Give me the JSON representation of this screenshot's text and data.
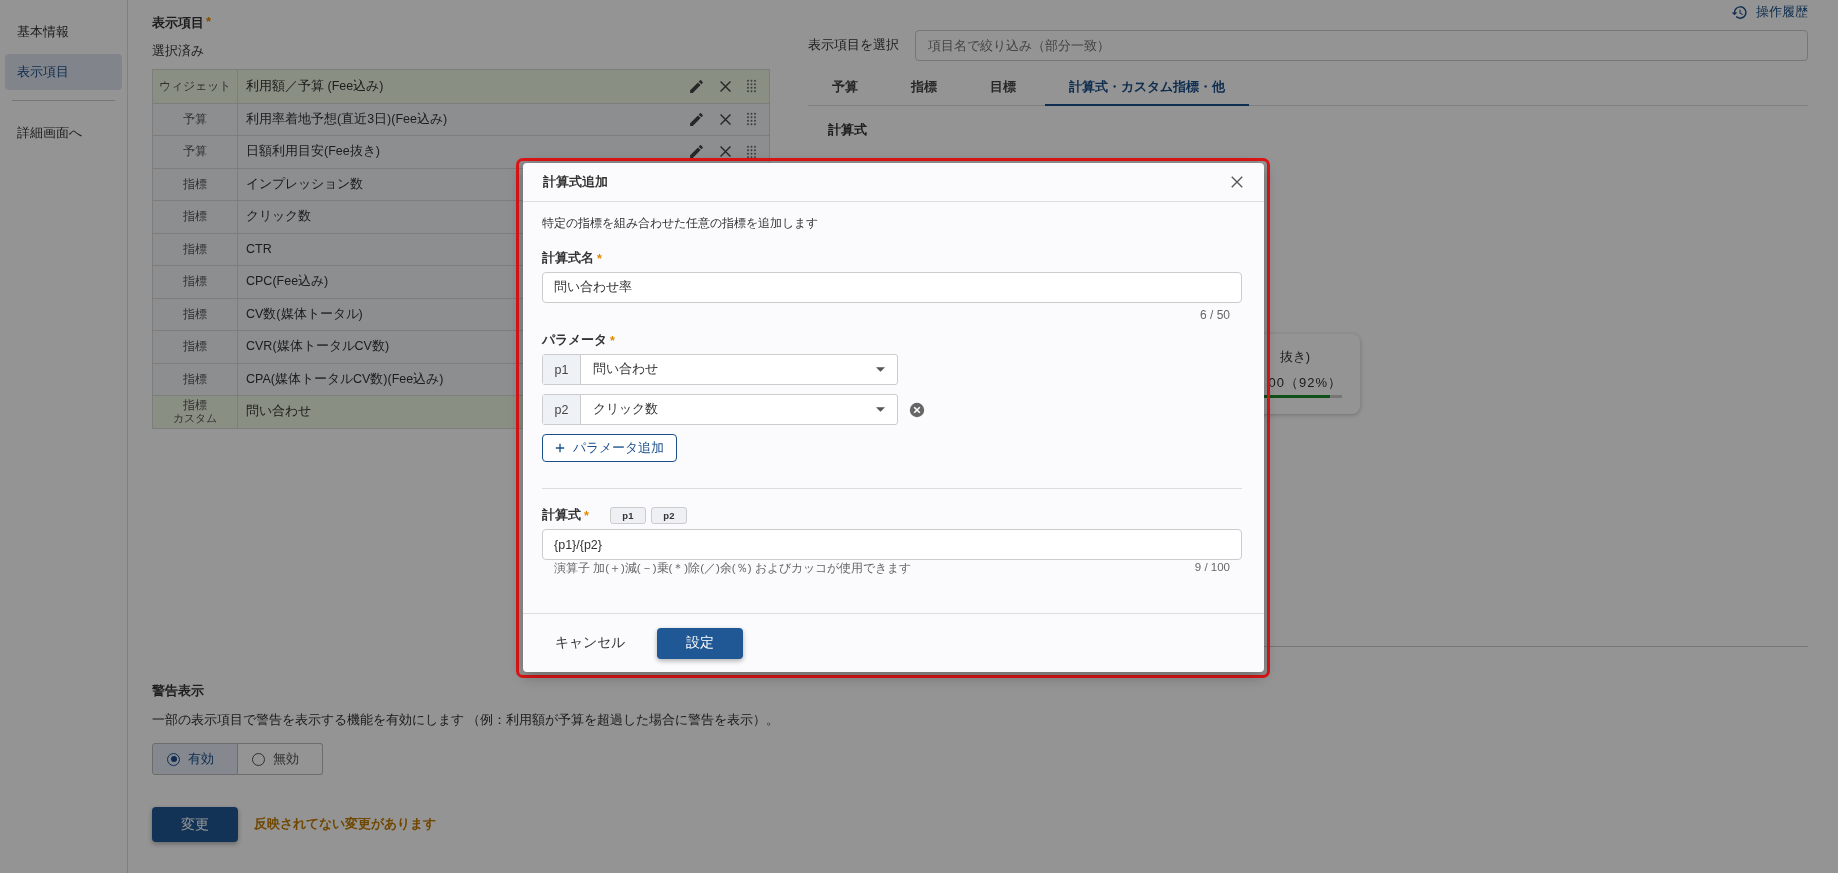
{
  "sidebar": {
    "items": [
      {
        "label": "基本情報",
        "selected": false
      },
      {
        "label": "表示項目",
        "selected": true
      }
    ],
    "links": [
      {
        "label": "詳細画面へ"
      }
    ]
  },
  "display_items": {
    "title": "表示項目",
    "required_mark": "*",
    "subtitle": "選択済み",
    "rows": [
      {
        "type": "ウィジェット",
        "name": "利用額／予算 (Fee込み)",
        "highlighted": true,
        "has_actions": true
      },
      {
        "type": "予算",
        "name": "利用率着地予想(直近3日)(Fee込み)",
        "highlighted": false,
        "has_actions": true
      },
      {
        "type": "予算",
        "name": "日額利用目安(Fee抜き)",
        "highlighted": false,
        "has_actions": true
      },
      {
        "type": "指標",
        "name": "インプレッション数",
        "highlighted": false
      },
      {
        "type": "指標",
        "name": "クリック数",
        "highlighted": false
      },
      {
        "type": "指標",
        "name": "CTR",
        "highlighted": false
      },
      {
        "type": "指標",
        "name": "CPC(Fee込み)",
        "highlighted": false
      },
      {
        "type": "指標",
        "name": "CV数(媒体トータル)",
        "highlighted": false
      },
      {
        "type": "指標",
        "name": "CVR(媒体トータルCV数)",
        "highlighted": false
      },
      {
        "type": "指標",
        "name": "CPA(媒体トータルCV数)(Fee込み)",
        "highlighted": false
      },
      {
        "type": "指標",
        "type_sub": "カスタム",
        "name": "問い合わせ",
        "highlighted": true
      }
    ]
  },
  "picker": {
    "history_link": "操作履歴",
    "label": "表示項目を選択",
    "search": {
      "placeholder": "項目名で絞り込み（部分一致）"
    },
    "tabs": [
      {
        "label": "予算",
        "selected": false
      },
      {
        "label": "指標",
        "selected": false
      },
      {
        "label": "目標",
        "selected": false
      },
      {
        "label": "計算式・カスタム指標・他",
        "selected": true
      }
    ],
    "section_title": "計算式",
    "card": {
      "title": "抜き)",
      "reading": "00（92%）",
      "level": 0.92
    }
  },
  "warning": {
    "title": "警告表示",
    "description": "一部の表示項目で警告を表示する機能を有効にします （例：利用額が予算を超過した場合に警告を表示）。",
    "options": [
      {
        "label": "有効",
        "selected": true
      },
      {
        "label": "無効",
        "selected": false
      }
    ],
    "submit": "変更",
    "notice": "反映されてない変更があります"
  },
  "modal": {
    "title": "計算式追加",
    "description": "特定の指標を組み合わせた任意の指標を追加します",
    "name_field": {
      "label": "計算式名",
      "required_mark": "*",
      "value": "問い合わせ率",
      "counter": "6 / 50"
    },
    "params": {
      "label": "パラメータ",
      "required_mark": "*",
      "rows": [
        {
          "key": "p1",
          "value": "問い合わせ",
          "removable": false
        },
        {
          "key": "p2",
          "value": "クリック数",
          "removable": true
        }
      ],
      "add_button": "パラメータ追加"
    },
    "formula": {
      "label": "計算式",
      "required_mark": "*",
      "chips": [
        "p1",
        "p2"
      ],
      "value": "{p1}/{p2}",
      "hint": "演算子 加(＋)減(－)乗(＊)除(／)余(％) およびカッコが使用できます",
      "counter": "9 / 100"
    },
    "cancel": "キャンセル",
    "confirm": "設定"
  }
}
